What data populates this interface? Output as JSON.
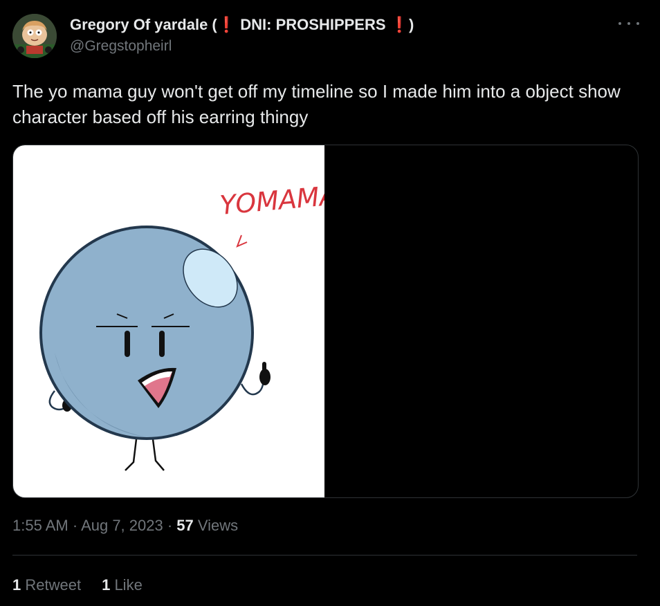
{
  "author": {
    "name_prefix": "Gregory Of yardale (",
    "warn_glyph": "❗",
    "name_middle": " DNI: PROSHIPPERS ",
    "name_suffix": ")",
    "handle": "@Gregstopheirl",
    "avatar_icon": "cartoon-character-avatar"
  },
  "more_icon": "more-horizontal-icon",
  "tweet": {
    "text": "The yo mama guy won't get off my timeline so I made him into a object show character based off his earring thingy"
  },
  "media": {
    "drawing_caption": "YOMAMA",
    "colors": {
      "ball": "#8fb1cc",
      "ball_outline": "#23384d",
      "highlight": "#cfe9f8",
      "mouth": "#e0768c",
      "caption": "#d9363e"
    }
  },
  "meta": {
    "time": "1:55 AM",
    "sep1": " · ",
    "date": "Aug 7, 2023",
    "sep2": " · ",
    "views_count": "57",
    "views_label": " Views"
  },
  "stats": {
    "retweets_count": "1",
    "retweets_label": " Retweet",
    "likes_count": "1",
    "likes_label": " Like"
  },
  "colors": {
    "background": "#000000",
    "text_primary": "#e7e9ea",
    "text_secondary": "#71767b",
    "border": "#2f3336",
    "warn": "#f4212e"
  }
}
